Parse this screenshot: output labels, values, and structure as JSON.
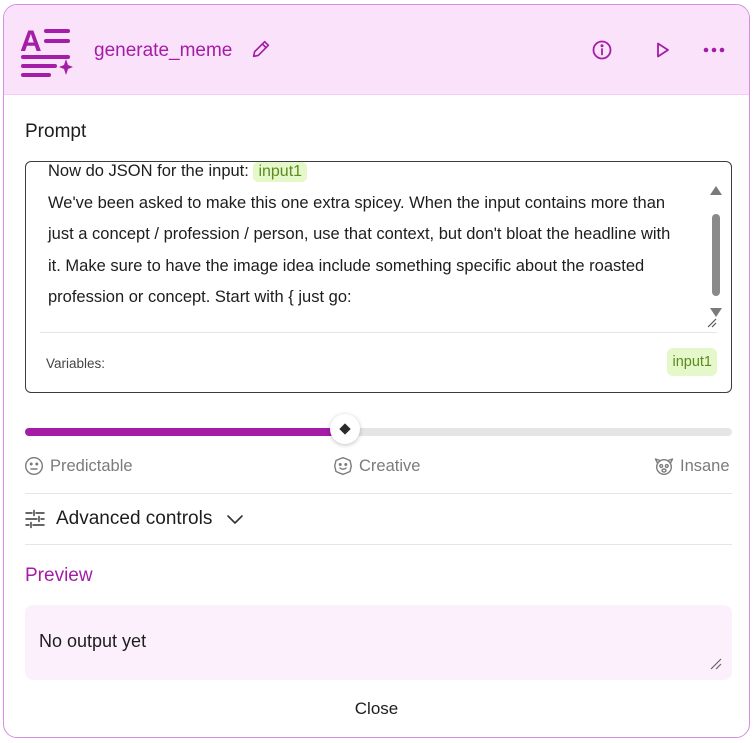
{
  "node": {
    "icon": "text-sparkle-icon",
    "title": "generate_meme",
    "accent_color": "#a31da6",
    "header_bg": "#fbe2fb"
  },
  "header_actions": {
    "edit_icon": "pencil-icon",
    "info_icon": "info-icon",
    "run_icon": "play-icon",
    "more_icon": "more-horizontal-icon"
  },
  "prompt": {
    "label": "Prompt",
    "line1_prefix": "Now do JSON for the input:",
    "line1_var": "input1",
    "body": "We've been asked to make this one extra spicey. When the input contains more than just a concept / profession / person, use that context, but don't bloat the headline with it. Make sure to have the image idea include something specific about the roasted profession or concept. Start with { just go:",
    "variables_label": "Variables:",
    "variables": [
      "input1"
    ],
    "variable_chip_color": "#e4f8c9"
  },
  "creativity": {
    "value": 0.452,
    "levels": [
      {
        "label": "Predictable",
        "icon": "neutral-face-icon"
      },
      {
        "label": "Creative",
        "icon": "creative-face-icon"
      },
      {
        "label": "Insane",
        "icon": "crazy-face-icon"
      }
    ]
  },
  "advanced": {
    "label": "Advanced controls",
    "icon": "sliders-icon",
    "chevron": "chevron-down-icon"
  },
  "preview": {
    "label": "Preview",
    "output": "No output yet"
  },
  "footer": {
    "close_label": "Close"
  }
}
